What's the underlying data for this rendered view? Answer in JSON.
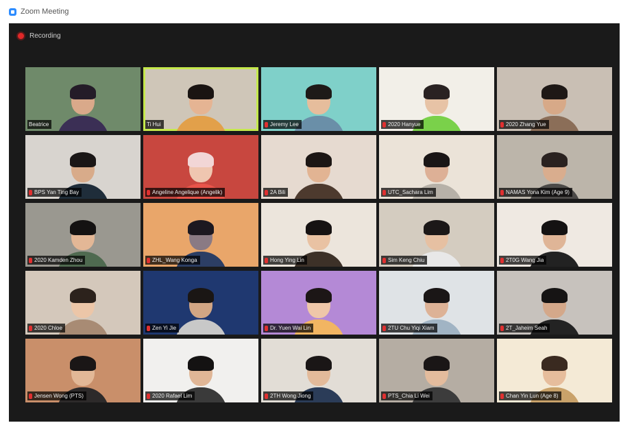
{
  "window": {
    "title": "Zoom Meeting"
  },
  "recording": {
    "label": "Recording"
  },
  "participants": [
    {
      "name": "Beatrice",
      "muted": false,
      "bg": "#6f8a6a",
      "shirt": "#3b2f55",
      "hair": "#241c28",
      "skin": "#d9a98a"
    },
    {
      "name": "Ti Hui",
      "muted": false,
      "bg": "#cfc6b8",
      "shirt": "#e2a04a",
      "hair": "#1a1412",
      "skin": "#e5b493",
      "active": true
    },
    {
      "name": "Jeremy Lee",
      "muted": true,
      "bg": "#7fd0c9",
      "shirt": "#6a8fa8",
      "hair": "#1e1a18",
      "skin": "#e6bd9c"
    },
    {
      "name": "2020 Hanyue",
      "muted": true,
      "bg": "#f2efe8",
      "shirt": "#7ad14a",
      "hair": "#2a2222",
      "skin": "#e7c3a6"
    },
    {
      "name": "2020 Zhang Yue",
      "muted": true,
      "bg": "#c9bfb4",
      "shirt": "#8b6e58",
      "hair": "#1e1816",
      "skin": "#d7a988"
    },
    {
      "name": "BPS Yan Ting Bay",
      "muted": true,
      "bg": "#d8d4cf",
      "shirt": "#1f2d3a",
      "hair": "#1a1616",
      "skin": "#d8ab8a"
    },
    {
      "name": "Angeline Angelique (Angelik)",
      "muted": true,
      "bg": "#c8473f",
      "shirt": "#e9544a",
      "hair": "#f2d6d6",
      "skin": "#efc6b0"
    },
    {
      "name": "2A Bili",
      "muted": true,
      "bg": "#e6dad0",
      "shirt": "#4d3a2e",
      "hair": "#1c1614",
      "skin": "#e2b493"
    },
    {
      "name": "UTC_Sachara Lim",
      "muted": true,
      "bg": "#ebe3d8",
      "shirt": "#b7b1a8",
      "hair": "#1a1616",
      "skin": "#ddb096"
    },
    {
      "name": "NAMAS Yona Kim (Age 9)",
      "muted": true,
      "bg": "#bcb5aa",
      "shirt": "#4c4a48",
      "hair": "#2a2220",
      "skin": "#d9ad8e"
    },
    {
      "name": "2020 Kamden Zhou",
      "muted": true,
      "bg": "#9a9890",
      "shirt": "#4f6a50",
      "hair": "#141212",
      "skin": "#e3b796"
    },
    {
      "name": "ZHL_Wang Konga",
      "muted": true,
      "bg": "#e9a66a",
      "shirt": "#2c3e64",
      "hair": "#1c1820",
      "skin": "#8a7a84"
    },
    {
      "name": "Hong Ying Lin",
      "muted": true,
      "bg": "#ece5dc",
      "shirt": "#3d3128",
      "hair": "#161212",
      "skin": "#e9c2a3"
    },
    {
      "name": "Sim Keng Chiu",
      "muted": true,
      "bg": "#d4ccc0",
      "shirt": "#e8e8e8",
      "hair": "#1c1818",
      "skin": "#e6c0a2"
    },
    {
      "name": "2T0G Wang Jia",
      "muted": true,
      "bg": "#efe9e2",
      "shirt": "#222222",
      "hair": "#141212",
      "skin": "#dfb597"
    },
    {
      "name": "2020 Chloe",
      "muted": true,
      "bg": "#d4c8bb",
      "shirt": "#a88b74",
      "hair": "#2c221c",
      "skin": "#ecc6a8"
    },
    {
      "name": "Zen Yi Jie",
      "muted": true,
      "bg": "#1f3870",
      "shirt": "#c8c8c8",
      "hair": "#1a1614",
      "skin": "#d2a684"
    },
    {
      "name": "Dr. Yuen Wai Lin",
      "muted": true,
      "bg": "#b489d6",
      "shirt": "#f2b562",
      "hair": "#1c1616",
      "skin": "#efc7a9"
    },
    {
      "name": "2TU Chu Yiqi Xiam",
      "muted": true,
      "bg": "#dfe3e6",
      "shirt": "#a1b4c4",
      "hair": "#1a1616",
      "skin": "#ddb296"
    },
    {
      "name": "2T_Jaheim Seah",
      "muted": true,
      "bg": "#c7c2bd",
      "shirt": "#232323",
      "hair": "#161414",
      "skin": "#d4a88a"
    },
    {
      "name": "Jensen Wong (PTS)",
      "muted": true,
      "bg": "#c98f6a",
      "shirt": "#2d2a2a",
      "hair": "#1a1616",
      "skin": "#e2b897"
    },
    {
      "name": "2020 Rafael Lim",
      "muted": true,
      "bg": "#f1f0ee",
      "shirt": "#3a3a3a",
      "hair": "#141212",
      "skin": "#e0b696"
    },
    {
      "name": "2TH Wong Jiong",
      "muted": true,
      "bg": "#e2ddd6",
      "shirt": "#2b3c58",
      "hair": "#1a1616",
      "skin": "#e3ba9a"
    },
    {
      "name": "PTS_Chia Li Wei",
      "muted": true,
      "bg": "#b5ada3",
      "shirt": "#3c3c3c",
      "hair": "#1a1616",
      "skin": "#e4bc9d"
    },
    {
      "name": "Chan Yin Lun (Age 8)",
      "muted": true,
      "bg": "#f4ead6",
      "shirt": "#c9a26a",
      "hair": "#3a2a20",
      "skin": "#e6bd9c"
    }
  ]
}
